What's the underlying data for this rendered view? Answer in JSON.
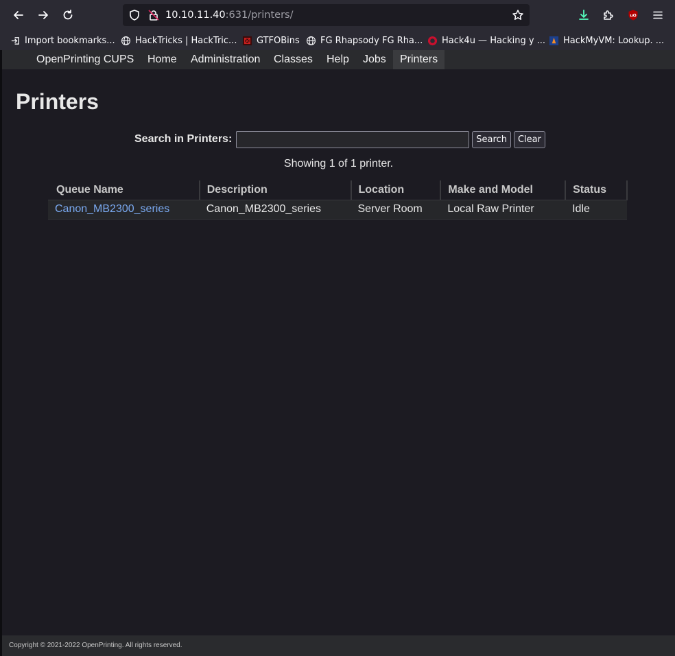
{
  "browser": {
    "url_host": "10.10.11.40",
    "url_rest": ":631/printers/",
    "bookmarks": [
      {
        "label": "Import bookmarks...",
        "icon": "import-icon"
      },
      {
        "label": "HackTricks | HackTric...",
        "icon": "globe-icon"
      },
      {
        "label": "GTFOBins",
        "icon": "gtfobins-icon"
      },
      {
        "label": "FG Rhapsody FG Rha...",
        "icon": "globe-icon"
      },
      {
        "label": "Hack4u — Hacking y ...",
        "icon": "hack4u-icon"
      },
      {
        "label": "HackMyVM: Lookup. ...",
        "icon": "hackmyvm-icon"
      }
    ],
    "colors": {
      "chrome": "#2b2a33",
      "download_accent": "#54ffbd",
      "ublock": "#b30000"
    }
  },
  "nav": {
    "items": [
      "OpenPrinting CUPS",
      "Home",
      "Administration",
      "Classes",
      "Help",
      "Jobs",
      "Printers"
    ],
    "active": "Printers"
  },
  "page": {
    "title": "Printers",
    "search_label": "Search in Printers:",
    "search_value": "",
    "search_button": "Search",
    "clear_button": "Clear",
    "showing": "Showing 1 of 1 printer."
  },
  "table": {
    "headers": [
      "Queue Name",
      "Description",
      "Location",
      "Make and Model",
      "Status"
    ],
    "rows": [
      [
        "Canon_MB2300_series",
        "Canon_MB2300_series",
        "Server Room",
        "Local Raw Printer",
        "Idle"
      ]
    ]
  },
  "footer": {
    "copyright": "Copyright © 2021-2022 OpenPrinting. All rights reserved."
  }
}
